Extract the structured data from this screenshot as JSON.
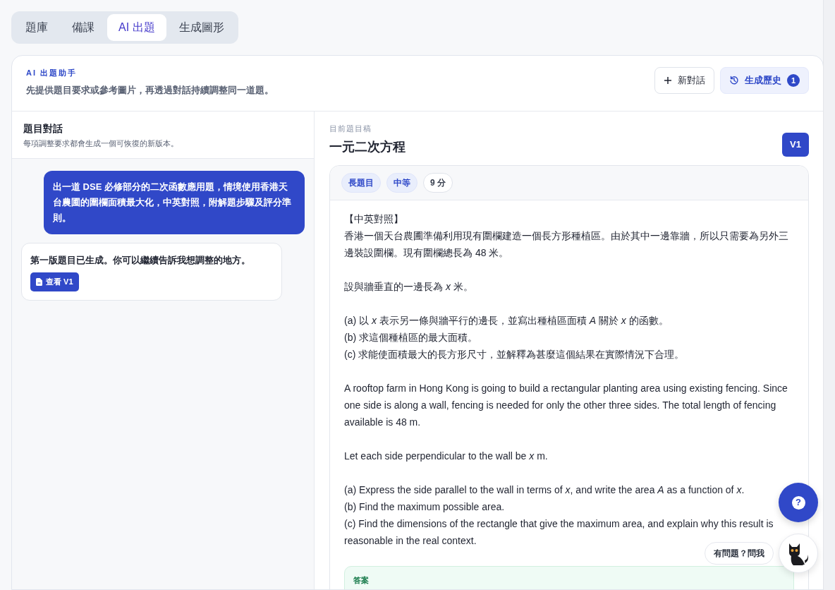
{
  "tabs": [
    {
      "label": "題庫",
      "selected": false
    },
    {
      "label": "備課",
      "selected": false
    },
    {
      "label": "AI 出題",
      "selected": true
    },
    {
      "label": "生成圖形",
      "selected": false
    }
  ],
  "header": {
    "eyebrow": "AI 出題助手",
    "subtitle": "先提供題目要求或參考圖片，再透過對話持續調整同一道題。",
    "buttons": [
      {
        "kind": "new",
        "label": "新對話"
      },
      {
        "kind": "history",
        "label": "生成歷史",
        "count": "1"
      }
    ]
  },
  "conversation": {
    "title": "題目對話",
    "subtitle": "每項調整要求都會生成一個可恢復的新版本。",
    "messages": [
      {
        "kind": "request",
        "text": "出一道 DSE 必修部分的二次函數應用題，情境使用香港天台農圃的圍欄面積最大化，中英對照，附解題步驟及評分準則。"
      },
      {
        "kind": "reply",
        "text": "第一版題目已生成。你可以繼續告訴我想調整的地方。",
        "action": "查看 V1"
      }
    ]
  },
  "draft": {
    "eyebrow": "目前題目稿",
    "title": "一元二次方程",
    "version": "V1",
    "tags": [
      {
        "kind": "type",
        "label": "長題目"
      },
      {
        "kind": "level",
        "label": "中等"
      },
      {
        "kind": "marks",
        "label": "9 分"
      }
    ],
    "blocks": [
      [
        "【中英對照】",
        "香港一個天台農圃準備利用現有圍欄建造一個長方形種植區。由於其中一邊靠牆，所以只需要為另外三邊裝設圍欄。現有圍欄總長為 48 米。"
      ],
      [
        "設與牆垂直的一邊長為 *x* 米。"
      ],
      [
        "(a) 以 *x* 表示另一條與牆平行的邊長，並寫出種植區面積 *A* 關於 *x* 的函數。",
        "(b) 求這個種植區的最大面積。",
        "(c) 求能使面積最大的長方形尺寸，並解釋為甚麼這個結果在實際情況下合理。"
      ],
      [
        "A rooftop farm in Hong Kong is going to build a rectangular planting area using existing fencing. Since one side is along a wall, fencing is needed for only the other three sides. The total length of fencing available is 48 m."
      ],
      [
        "Let each side perpendicular to the wall be *x* m."
      ],
      [
        "(a) Express the side parallel to the wall in terms of *x*, and write the area *A* as a function of *x*.",
        "(b) Find the maximum possible area.",
        "(c) Find the dimensions of the rectangle that give the maximum area, and explain why this result is",
        "reasonable in the real context."
      ]
    ],
    "answer_label": "答案"
  },
  "help": {
    "button": "?",
    "chat_label": "有問題？問我"
  }
}
